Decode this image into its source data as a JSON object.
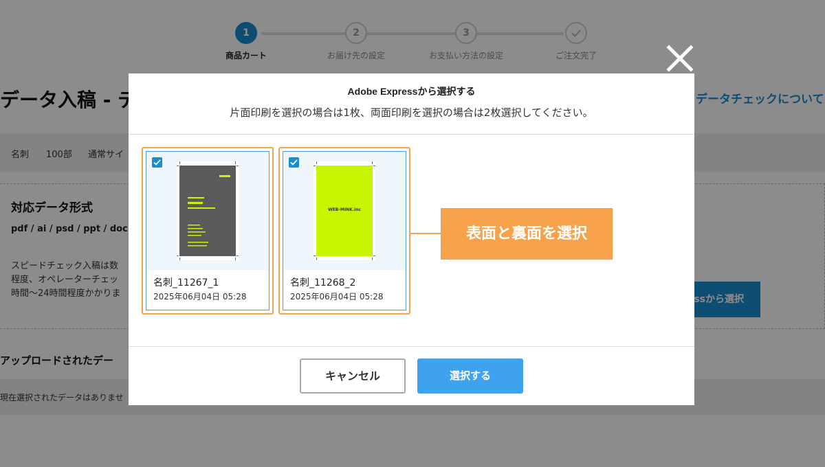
{
  "stepper": {
    "steps": [
      {
        "number": "1",
        "label": "商品カート"
      },
      {
        "number": "2",
        "label": "お届け先の設定"
      },
      {
        "number": "3",
        "label": "お支払い方法の設定"
      },
      {
        "number": "",
        "label": "ご注文完了"
      }
    ]
  },
  "page": {
    "title": "データ入稿 - デ",
    "datacheck_link": "データチェックについて",
    "info_bar": {
      "item1": "名刺",
      "item2": "100部",
      "item3": "通常サイ"
    },
    "format": {
      "title": "対応データ形式",
      "list": "pdf / ai / psd / ppt / doc /",
      "desc_line1": "スピードチェック入稿は数",
      "desc_line2": "程度、オペレーターチェッ",
      "desc_line3": "時間〜24時間程度かかりま",
      "express_button": "ssから選択"
    },
    "uploaded": {
      "title": "アップロードされたデー",
      "empty": "現在選択されたデータはありませ"
    }
  },
  "modal": {
    "title": "Adobe Expressから選択する",
    "subtitle": "片面印刷を選択の場合は1枚、両面印刷を選択の場合は2枚選択してください。",
    "cards": [
      {
        "name": "名刺_11267_1",
        "date": "2025年06月04日 05:28",
        "checked": true,
        "front_color": "#5b5b5b",
        "text_color": "#c9f500"
      },
      {
        "name": "名刺_11268_2",
        "date": "2025年06月04日 05:28",
        "checked": true,
        "front_color": "#c9f500",
        "text_color": "#4a4a4a"
      }
    ],
    "card2_logo": "WEB-MINK.inc",
    "callout": "表面と裏面を選択",
    "cancel_label": "キャンセル",
    "select_label": "選択する"
  },
  "colors": {
    "accent_blue": "#1b8ccf",
    "button_blue": "#3ea2ee",
    "highlight_orange": "#f5a24a"
  }
}
